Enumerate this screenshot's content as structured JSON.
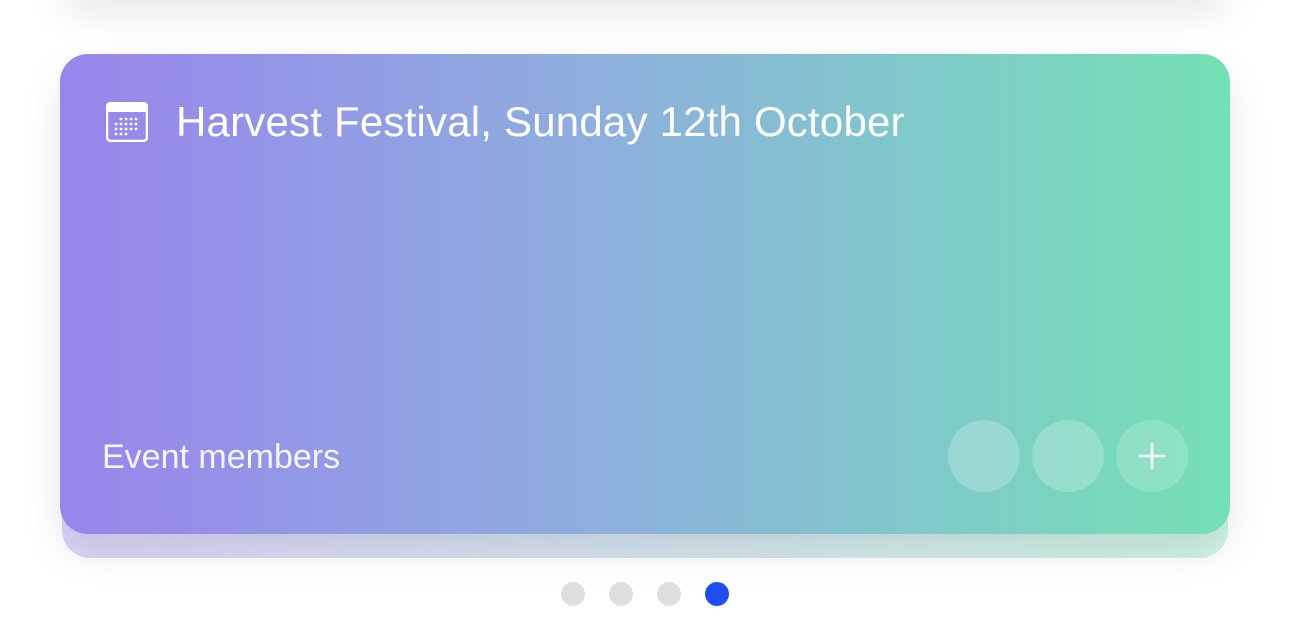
{
  "event_card": {
    "title": "Harvest Festival, Sunday 12th October",
    "members_label": "Event members",
    "member_count_shown": 2,
    "gradient_start": "#9785ec",
    "gradient_end": "#74e1b4",
    "icons": {
      "calendar": "calendar-icon",
      "add": "plus-icon"
    }
  },
  "pagination": {
    "total": 4,
    "active_index": 3,
    "active_color": "#1f4df0",
    "inactive_color": "#dedede"
  }
}
